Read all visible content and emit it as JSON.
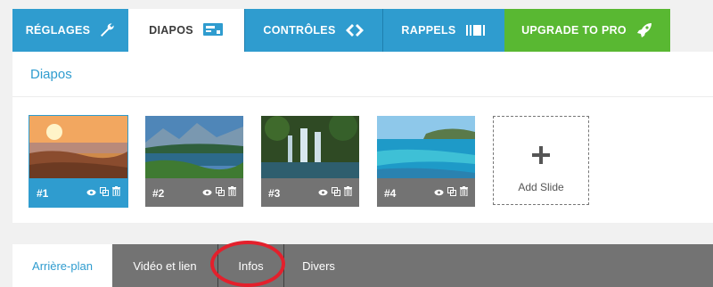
{
  "top_tabs": [
    {
      "label": "RÉGLAGES",
      "icon": "wrench-icon"
    },
    {
      "label": "DIAPOS",
      "icon": "slides-icon"
    },
    {
      "label": "CONTRÔLES",
      "icon": "arrows-icon"
    },
    {
      "label": "RAPPELS",
      "icon": "carousel-icon"
    },
    {
      "label": "UPGRADE TO PRO",
      "icon": "rocket-icon"
    }
  ],
  "panel": {
    "title": "Diapos"
  },
  "slides": [
    {
      "number": "#1",
      "active": true
    },
    {
      "number": "#2",
      "active": false
    },
    {
      "number": "#3",
      "active": false
    },
    {
      "number": "#4",
      "active": false
    }
  ],
  "add_slide": {
    "label": "Add Slide"
  },
  "sub_tabs": [
    {
      "label": "Arrière-plan",
      "active": true
    },
    {
      "label": "Vidéo et lien",
      "active": false
    },
    {
      "label": "Infos",
      "active": false
    },
    {
      "label": "Divers",
      "active": false
    }
  ],
  "colors": {
    "accent": "#2f9ccf",
    "upgrade": "#59b832",
    "highlight": "#e3202c",
    "bar": "#737373"
  }
}
